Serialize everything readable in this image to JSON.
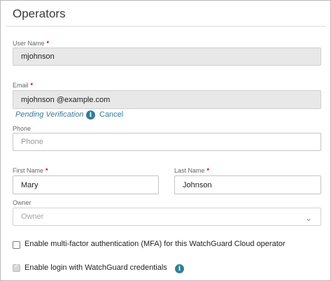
{
  "panel": {
    "title": "Operators"
  },
  "user_name": {
    "label": "User Name",
    "required_mark": "*",
    "value": "mjohnson"
  },
  "email": {
    "label": "Email",
    "required_mark": "*",
    "value": "mjohnson @example.com",
    "status": "Pending Verification",
    "info_icon": "i",
    "cancel_label": "Cancel"
  },
  "phone": {
    "label": "Phone",
    "placeholder": "Phone"
  },
  "first_name": {
    "label": "First Name",
    "required_mark": "*",
    "value": "Mary"
  },
  "last_name": {
    "label": "Last Name",
    "required_mark": "*",
    "value": "Johnson"
  },
  "owner": {
    "label": "Owner",
    "selected": "Owner",
    "chevron_icon": "chevron-down"
  },
  "mfa": {
    "label": "Enable multi-factor authentication (MFA) for this WatchGuard Cloud operator",
    "checked": false
  },
  "wg_login": {
    "label": "Enable login with WatchGuard credentials",
    "checked": true,
    "info_icon": "i"
  },
  "colors": {
    "accent": "#2f7f97",
    "required": "#d0021b",
    "readonly_bg": "#e8e8e8"
  }
}
